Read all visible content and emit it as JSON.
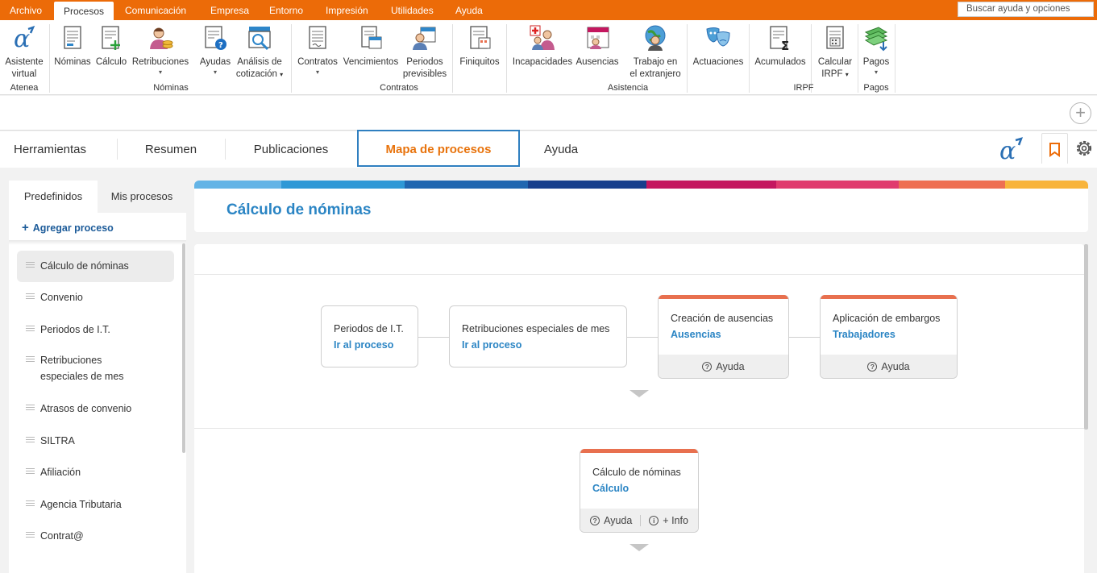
{
  "menu": {
    "items": [
      {
        "label": "Archivo"
      },
      {
        "label": "Procesos"
      },
      {
        "label": "Comunicación"
      },
      {
        "label": "Empresa"
      },
      {
        "label": "Entorno"
      },
      {
        "label": "Impresión"
      },
      {
        "label": "Utilidades"
      },
      {
        "label": "Ayuda"
      }
    ],
    "search_placeholder": "Buscar ayuda y opciones"
  },
  "ribbon": {
    "buttons": {
      "asistente": [
        "Asistente",
        "virtual"
      ],
      "nominas": "Nóminas",
      "calculo": "Cálculo",
      "retribuciones": "Retribuciones",
      "ayudas": "Ayudas",
      "analisis": [
        "Análisis de",
        "cotización"
      ],
      "contratos": "Contratos",
      "vencimientos": "Vencimientos",
      "periodos": [
        "Periodos",
        "previsibles"
      ],
      "finiquitos": "Finiquitos",
      "incapacidades": "Incapacidades",
      "ausencias": "Ausencias",
      "trabajo": [
        "Trabajo en",
        "el extranjero"
      ],
      "actuaciones": "Actuaciones",
      "acumulados": "Acumulados",
      "calcular_irpf": [
        "Calcular",
        "IRPF"
      ],
      "pagos": "Pagos"
    },
    "groups": {
      "atenea": "Atenea",
      "nominas": "Nóminas",
      "contratos": "Contratos",
      "asistencia": "Asistencia",
      "irpf": "IRPF",
      "pagos": "Pagos"
    },
    "dropdown_glyph": "▾"
  },
  "strip": {
    "add_glyph": "+"
  },
  "tabs": [
    {
      "label": "Herramientas"
    },
    {
      "label": "Resumen"
    },
    {
      "label": "Publicaciones"
    },
    {
      "label": "Mapa de procesos"
    },
    {
      "label": "Ayuda"
    }
  ],
  "left": {
    "tabs": [
      {
        "label": "Predefinidos"
      },
      {
        "label": "Mis procesos"
      }
    ],
    "add_process": "Agregar proceso",
    "processes": [
      {
        "label": "Cálculo de nóminas"
      },
      {
        "label": "Convenio"
      },
      {
        "label": "Periodos de I.T."
      },
      {
        "label": "Retribuciones especiales de mes"
      },
      {
        "label": "Atrasos de convenio"
      },
      {
        "label": "SILTRA"
      },
      {
        "label": "Afiliación"
      },
      {
        "label": "Agencia Tributaria"
      },
      {
        "label": "Contrat@"
      }
    ]
  },
  "content": {
    "title": "Cálculo de nóminas",
    "rainbow_colors": [
      "#64b4e6",
      "#2e98d6",
      "#1f66b0",
      "#173f8c",
      "#c4175f",
      "#e03b6e",
      "#ee6f52",
      "#f8b43b"
    ],
    "nodes": [
      {
        "title": "Periodos de I.T.",
        "link": "Ir al proceso"
      },
      {
        "title": "Retribuciones especiales de mes",
        "link": "Ir al proceso"
      },
      {
        "title": "Creación de ausencias",
        "link": "Ausencias",
        "help": "Ayuda"
      },
      {
        "title": "Aplicación de embargos",
        "link": "Trabajadores",
        "help": "Ayuda"
      },
      {
        "title": "Cálculo de nóminas",
        "link": "Cálculo",
        "help": "Ayuda",
        "info": "+ Info"
      }
    ]
  }
}
